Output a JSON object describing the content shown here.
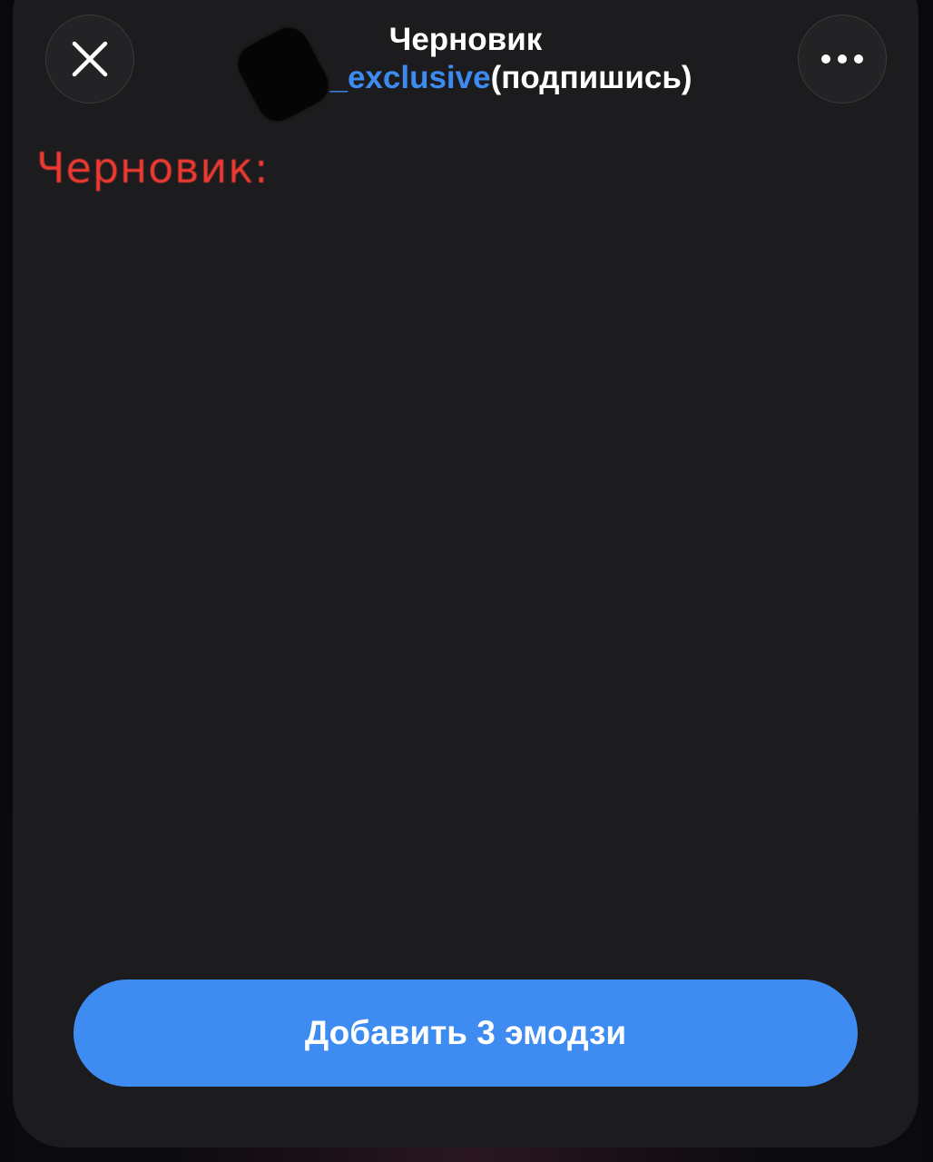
{
  "header": {
    "title": "Черновик",
    "channel_link": "_exclusive",
    "channel_suffix": "(подпишись)",
    "close_icon": "close-icon",
    "more_icon": "more-horizontal-icon"
  },
  "main": {
    "draft_label": "Черновик:"
  },
  "footer": {
    "add_button_label": "Добавить 3 эмодзи"
  },
  "colors": {
    "sheet_background": "#1c1c1e",
    "accent": "#3e8cf1",
    "link": "#3d8bf0",
    "draft_label": "#ee3a32"
  }
}
